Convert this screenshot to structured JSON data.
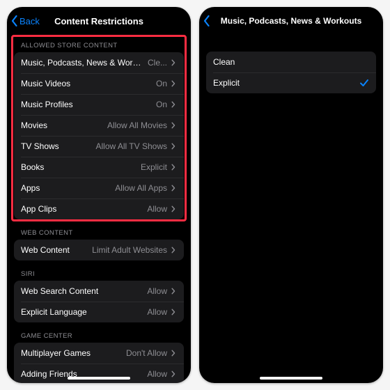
{
  "left": {
    "back_label": "Back",
    "title": "Content Restrictions",
    "groups": [
      {
        "header": "ALLOWED STORE CONTENT",
        "highlight": true,
        "rows": [
          {
            "label": "Music, Podcasts, News & Workouts",
            "value": "Cle..."
          },
          {
            "label": "Music Videos",
            "value": "On"
          },
          {
            "label": "Music Profiles",
            "value": "On"
          },
          {
            "label": "Movies",
            "value": "Allow All Movies"
          },
          {
            "label": "TV Shows",
            "value": "Allow All TV Shows"
          },
          {
            "label": "Books",
            "value": "Explicit"
          },
          {
            "label": "Apps",
            "value": "Allow All Apps"
          },
          {
            "label": "App Clips",
            "value": "Allow"
          }
        ]
      },
      {
        "header": "WEB CONTENT",
        "rows": [
          {
            "label": "Web Content",
            "value": "Limit Adult Websites"
          }
        ]
      },
      {
        "header": "SIRI",
        "rows": [
          {
            "label": "Web Search Content",
            "value": "Allow"
          },
          {
            "label": "Explicit Language",
            "value": "Allow"
          }
        ]
      },
      {
        "header": "GAME CENTER",
        "rows": [
          {
            "label": "Multiplayer Games",
            "value": "Don't Allow"
          },
          {
            "label": "Adding Friends",
            "value": "Allow"
          }
        ]
      }
    ]
  },
  "right": {
    "title": "Music, Podcasts, News & Workouts",
    "options": [
      {
        "label": "Clean",
        "selected": false
      },
      {
        "label": "Explicit",
        "selected": true
      }
    ]
  }
}
